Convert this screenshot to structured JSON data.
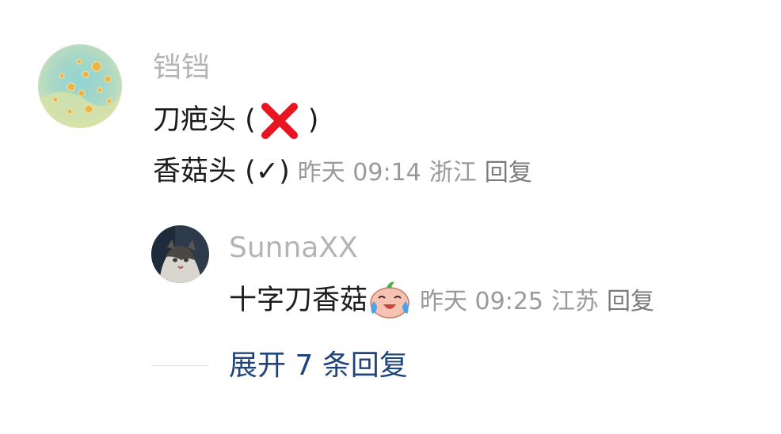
{
  "comment": {
    "author": "铛铛",
    "text_line1_prefix": "刀疤头 (",
    "text_line1_suffix": ")",
    "text_line2": "香菇头 (✓)",
    "time": "昨天 09:14",
    "location": "浙江",
    "reply_label": "回复"
  },
  "reply": {
    "author": "SunnaXX",
    "text": "十字刀香菇",
    "time": "昨天 09:25",
    "location": "江苏",
    "reply_label": "回复"
  },
  "expand": {
    "label": "展开 7 条回复"
  },
  "icons": {
    "cross": "red-cross-mark-icon",
    "emoji": "crying-laughing-emoji-icon"
  },
  "colors": {
    "username": "#b4b4b4",
    "meta": "#999999",
    "link": "#20457a",
    "cross": "#e8141f"
  }
}
